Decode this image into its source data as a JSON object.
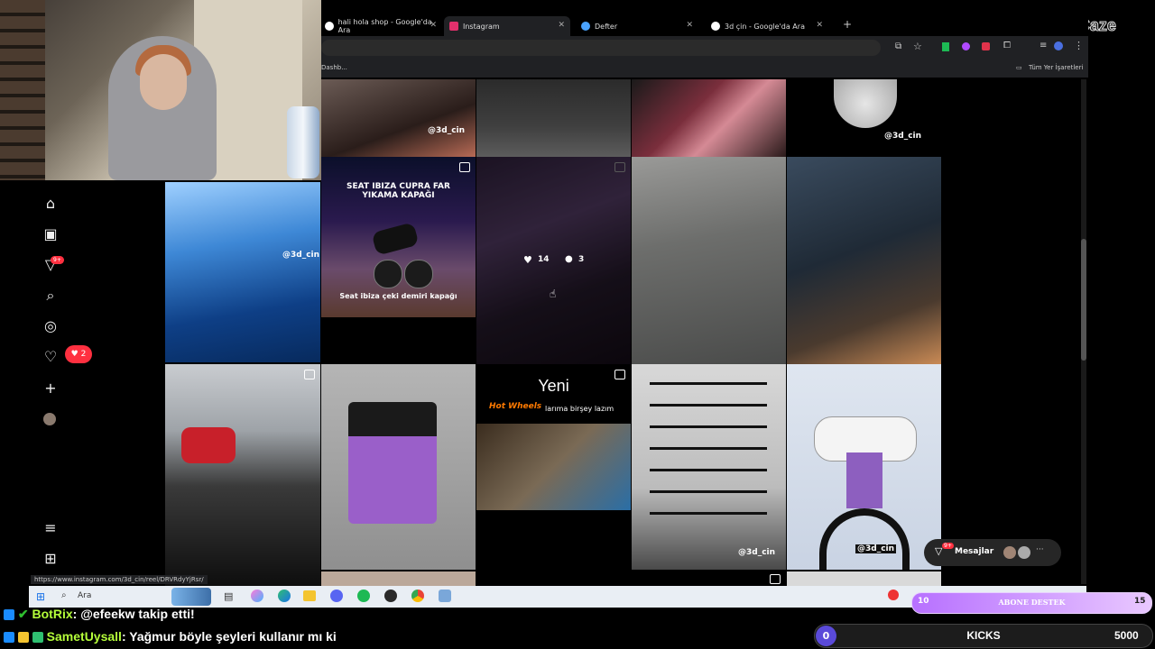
{
  "stream_logo": "ByNoCaze",
  "tabs": [
    {
      "label": "hali hola shop - Google'da Ara",
      "color": "#ffffff"
    },
    {
      "label": "Instagram",
      "color": "#e1306c"
    },
    {
      "label": "Defter",
      "color": "#4aa3ff"
    },
    {
      "label": "3d çin - Google'da Ara",
      "color": "#ffffff"
    }
  ],
  "bookmarks": {
    "left": "Dashb...",
    "right": "Tüm Yer İşaretleri"
  },
  "status_url": "https://www.instagram.com/3d_cin/reel/DRVRdyYjRsr/",
  "grid": {
    "watermark": "@3d_cin",
    "seat_title": "SEAT IBIZA CUPRA  FAR YIKAMA KAPAĞI",
    "seat_sub": "Seat ibiza çeki demiri kapağı",
    "likes": "14",
    "comments": "3",
    "yeni": "Yeni",
    "hotwheels_text": "larıma birşey lazım",
    "hotwheels_brand": "Hot Wheels"
  },
  "notifications_badge": "9+",
  "likes_badge": "2",
  "messages": {
    "label": "Mesajlar",
    "badge": "9+"
  },
  "taskbar": {
    "search_placeholder": "Ara"
  },
  "chat": [
    {
      "user": "BotRix",
      "message": ": @efeekw takip etti!",
      "color": "#b5ff3a"
    },
    {
      "user": "SametUysall",
      "message": ": Yağmur böyle şeyleri kullanır mı ki",
      "color": "#b5ff3a"
    }
  ],
  "abone": {
    "left": "10",
    "label": "ABONE DESTEK",
    "right": "15"
  },
  "kicks": {
    "left": "0",
    "label": "KICKS",
    "right": "5000"
  }
}
